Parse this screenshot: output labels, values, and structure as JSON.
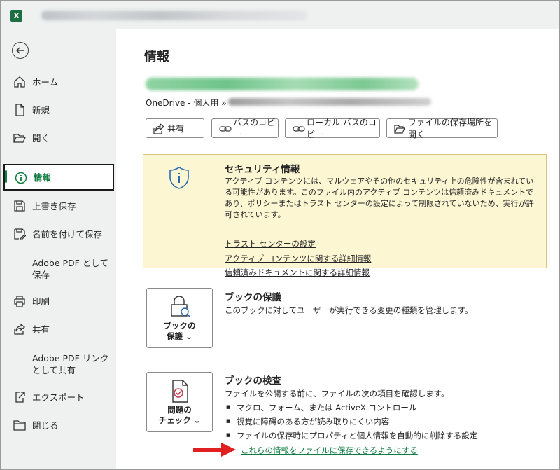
{
  "titlebar": {
    "app_icon": "excel-icon"
  },
  "sidebar": {
    "items": [
      {
        "label": "ホーム",
        "icon": "home-icon"
      },
      {
        "label": "新規",
        "icon": "new-document-icon"
      },
      {
        "label": "開く",
        "icon": "open-folder-icon"
      },
      {
        "label": "情報",
        "icon": "info-icon",
        "active": true
      },
      {
        "label": "上書き保存",
        "icon": "save-icon"
      },
      {
        "label": "名前を付けて保存",
        "icon": "save-as-icon"
      },
      {
        "label": "Adobe PDF として保存",
        "icon": ""
      },
      {
        "label": "印刷",
        "icon": "print-icon"
      },
      {
        "label": "共有",
        "icon": "share-icon"
      },
      {
        "label": "Adobe PDF リンクとして共有",
        "icon": ""
      },
      {
        "label": "エクスポート",
        "icon": "export-icon"
      },
      {
        "label": "閉じる",
        "icon": "close-folder-icon"
      }
    ]
  },
  "main": {
    "title": "情報",
    "location_prefix": "OneDrive - 個人用 »",
    "buttons": {
      "share": "共有",
      "copy_path": "パスのコピー",
      "copy_local_path": "ローカル パスのコピー",
      "open_location": "ファイルの保存場所を開く"
    },
    "security": {
      "title": "セキュリティ情報",
      "description": "アクティブ コンテンツには、マルウェアやその他のセキュリティ上の危険性が含まれている可能性があります。このファイル内のアクティブ コンテンツは信頼済みドキュメントであり、ポリシーまたはトラスト センターの設定によって制限されていないため、実行が許可されています。",
      "links": [
        "トラスト センターの設定",
        "アクティブ コンテンツに関する詳細情報",
        "信頼済みドキュメントに関する詳細情報"
      ]
    },
    "protect": {
      "button_line1": "ブックの",
      "button_line2": "保護 ⌄",
      "title": "ブックの保護",
      "description": "このブックに対してユーザーが実行できる変更の種類を管理します。"
    },
    "inspect": {
      "button_line1": "問題の",
      "button_line2": "チェック ⌄",
      "title": "ブックの検査",
      "description": "ファイルを公開する前に、ファイルの次の項目を確認します。",
      "bullets": [
        "マクロ、フォーム、または ActiveX コントロール",
        "視覚に障碍のある方が読み取りにくい内容",
        "ファイルの保存時にプロパティと個人情報を自動的に削除する設定"
      ],
      "link": "これらの情報をファイルに保存できるようにする"
    }
  },
  "colors": {
    "accent": "#107c41",
    "sidebar_bg": "#eef1f0",
    "security_bg": "#fdf6d3",
    "arrow": "#e02020"
  }
}
